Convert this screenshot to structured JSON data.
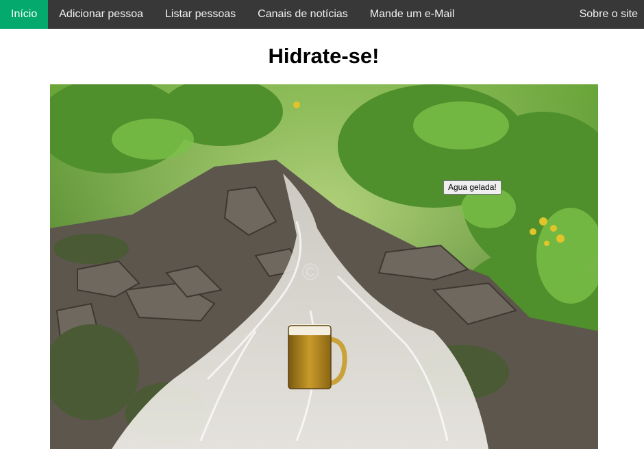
{
  "nav": {
    "items": [
      {
        "label": "Início",
        "active": true
      },
      {
        "label": "Adicionar pessoa"
      },
      {
        "label": "Listar pessoas"
      },
      {
        "label": "Canais de notícias"
      },
      {
        "label": "Mande um e-Mail"
      }
    ],
    "right_item": {
      "label": "Sobre o site"
    },
    "colors": {
      "bar": "#383838",
      "active": "#04aa6d"
    }
  },
  "main": {
    "title": "Hidrate-se!",
    "image_button": {
      "label": "Agua gelada!"
    }
  }
}
